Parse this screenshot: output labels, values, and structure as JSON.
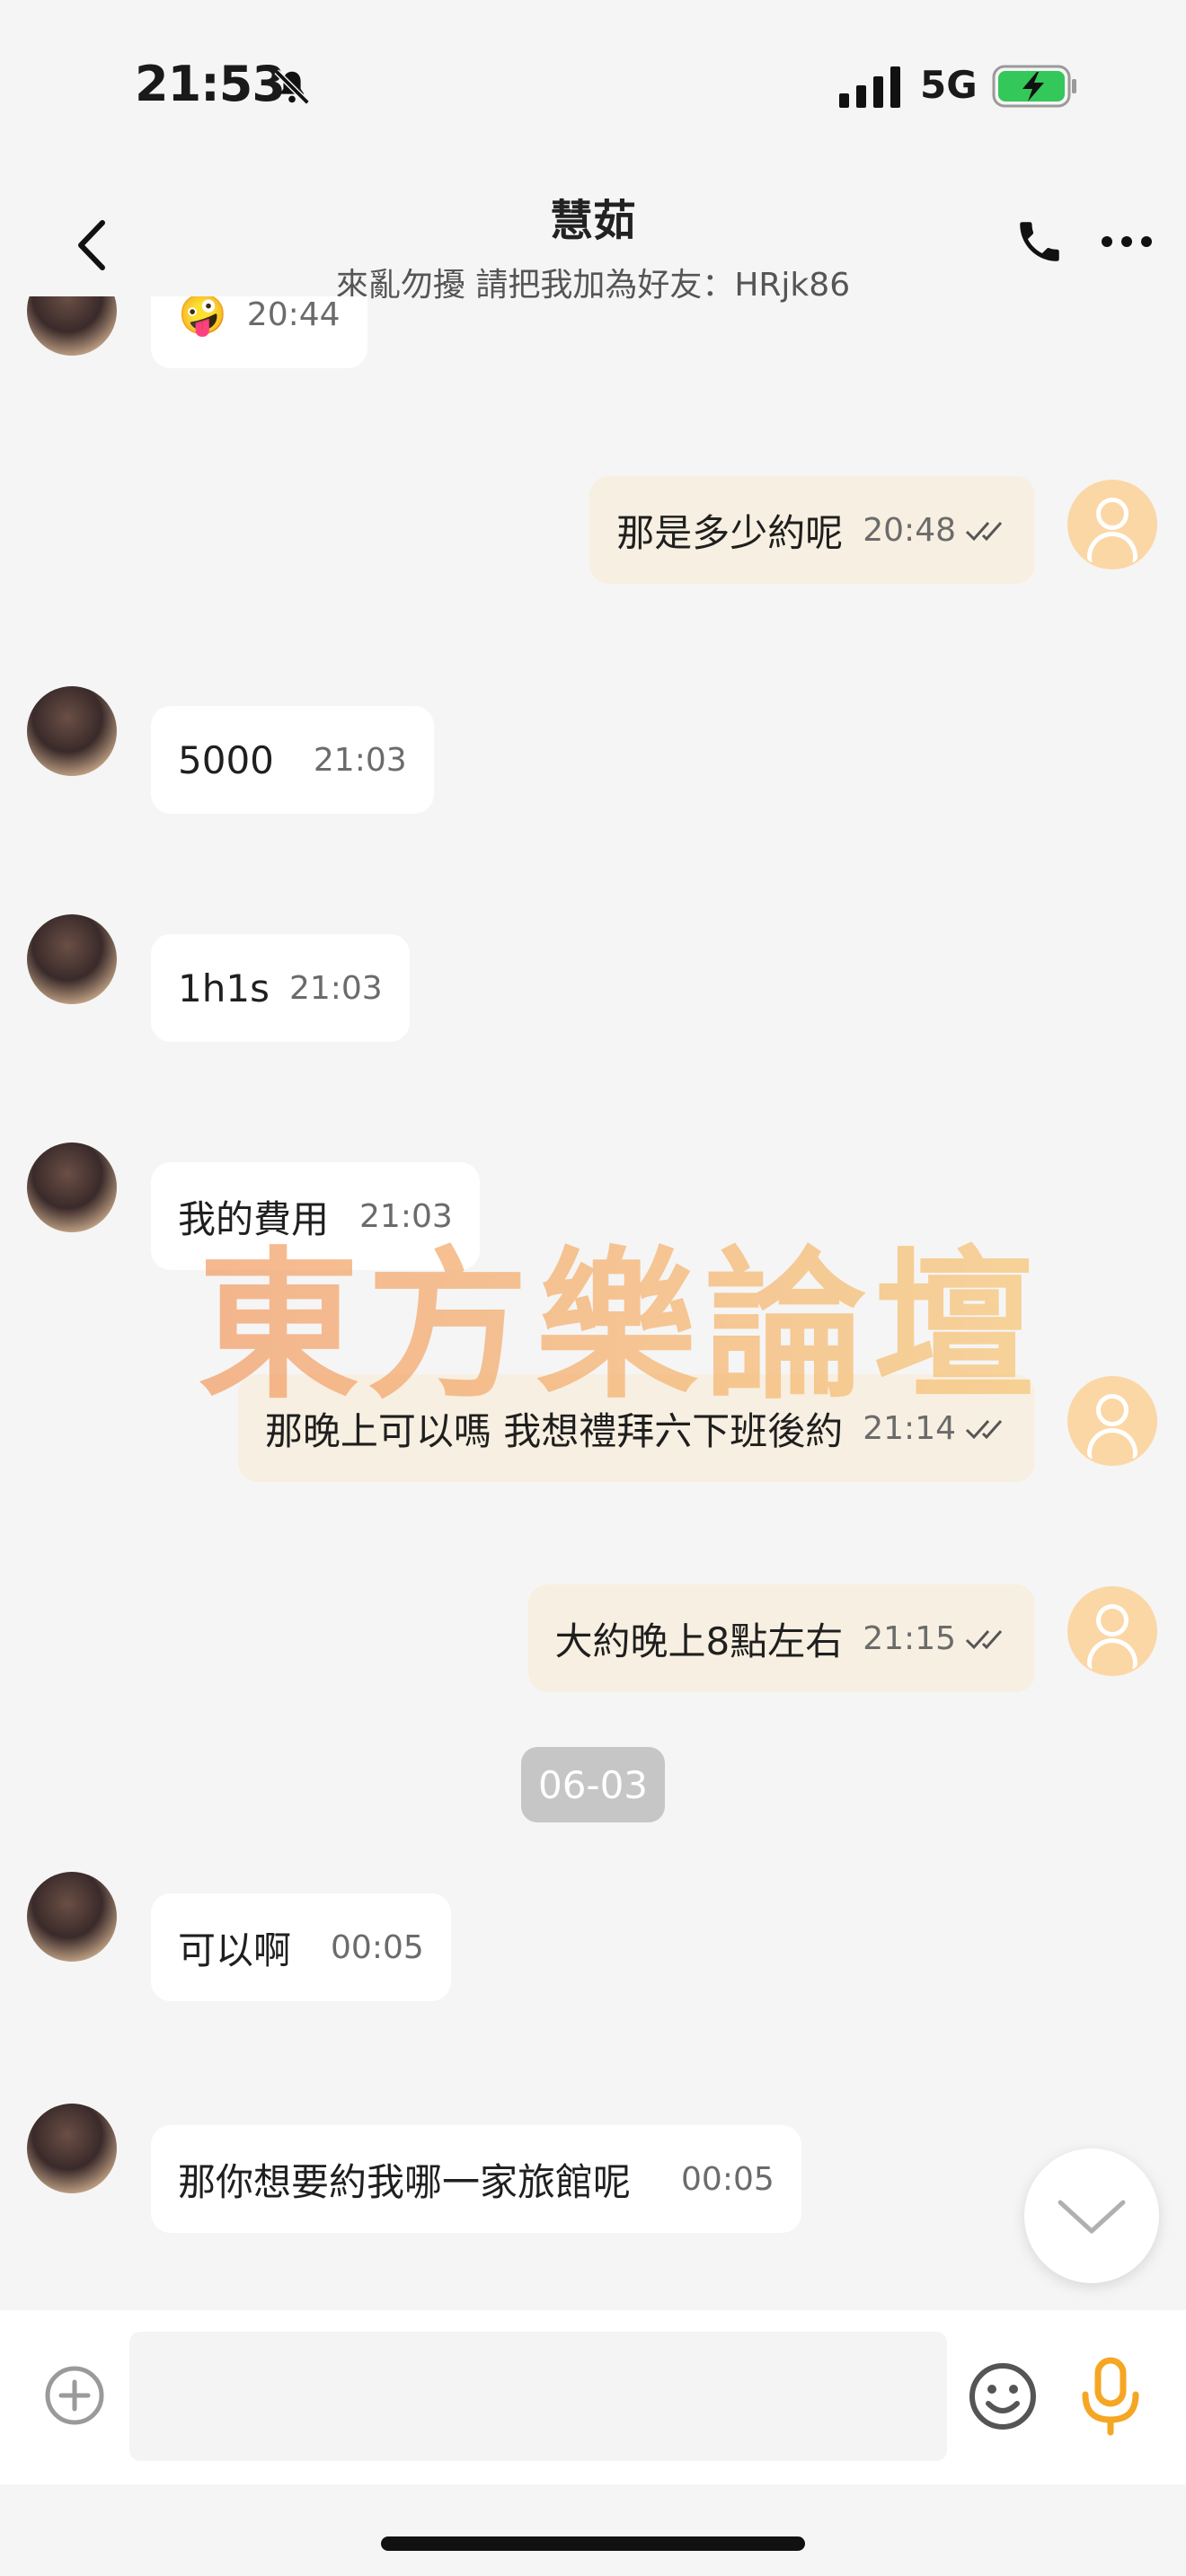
{
  "status_bar": {
    "time": "21:53",
    "network": "5G"
  },
  "header": {
    "title": "慧茹",
    "subtitle": "來亂勿擾 請把我加為好友：HRjk86"
  },
  "messages": [
    {
      "direction": "in",
      "emoji": "🤪",
      "time": "20:44"
    },
    {
      "direction": "out",
      "text": "那是多少約呢",
      "time": "20:48"
    },
    {
      "direction": "in",
      "text": "5000",
      "time": "21:03"
    },
    {
      "direction": "in",
      "text": "1h1s",
      "time": "21:03"
    },
    {
      "direction": "in",
      "text": "我的費用",
      "time": "21:03"
    },
    {
      "direction": "out",
      "text": "那晚上可以嗎 我想禮拜六下班後約",
      "time": "21:14"
    },
    {
      "direction": "out",
      "text": "大約晚上8點左右",
      "time": "21:15"
    },
    {
      "direction": "in",
      "text": "可以啊",
      "time": "00:05"
    },
    {
      "direction": "in",
      "text": "那你想要約我哪一家旅館呢",
      "time": "00:05"
    }
  ],
  "date_divider": "06-03",
  "watermark": "東方樂論壇",
  "input": {
    "placeholder": ""
  },
  "icons": {
    "back": "chevron-left-icon",
    "phone": "phone-icon",
    "more": "more-icon",
    "plus": "plus-icon",
    "emoji": "emoji-icon",
    "mic": "microphone-icon",
    "scroll": "chevron-down-icon"
  },
  "colors": {
    "outgoing_bubble": "#f7efe1",
    "incoming_bubble": "#ffffff",
    "accent": "#f5a623",
    "avatar_placeholder": "#fbd7a6"
  }
}
